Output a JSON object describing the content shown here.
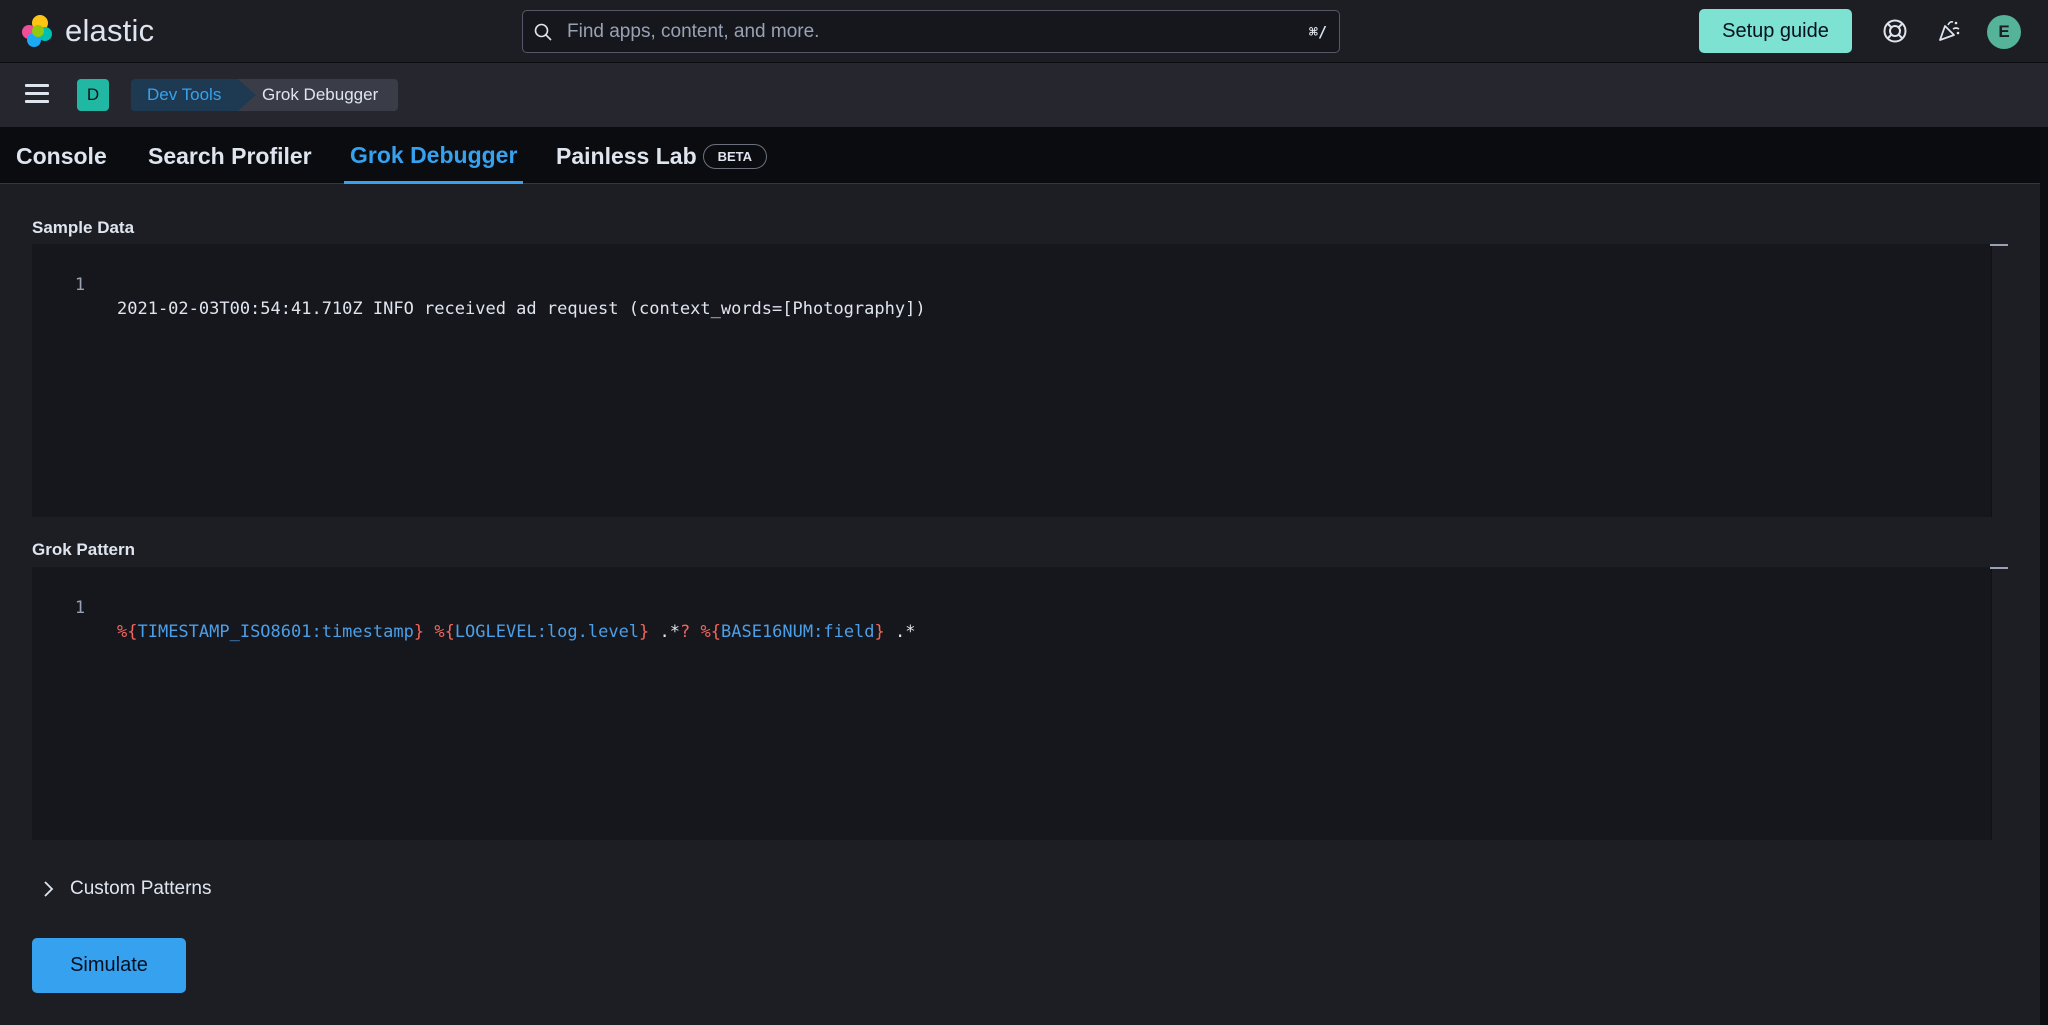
{
  "header": {
    "logo_text": "elastic",
    "search_placeholder": "Find apps, content, and more.",
    "search_shortcut": "⌘/",
    "setup_guide_label": "Setup guide",
    "icons": [
      "help-icon",
      "newsfeed-icon",
      "user-avatar"
    ],
    "avatar_initial": "E"
  },
  "nav": {
    "space_initial": "D",
    "breadcrumbs": [
      "Dev Tools",
      "Grok Debugger"
    ]
  },
  "tabs": [
    {
      "label": "Console",
      "active": false
    },
    {
      "label": "Search Profiler",
      "active": false
    },
    {
      "label": "Grok Debugger",
      "active": true
    },
    {
      "label": "Painless Lab",
      "active": false,
      "badge": "BETA"
    }
  ],
  "sample_data": {
    "label": "Sample Data",
    "line_number": "1",
    "text": "2021-02-03T00:54:41.710Z INFO received ad request (context_words=[Photography])"
  },
  "grok_pattern": {
    "label": "Grok Pattern",
    "line_number": "1",
    "tokens": [
      {
        "text": "%{",
        "color": "red"
      },
      {
        "text": "TIMESTAMP_ISO8601:timestamp",
        "color": "blue"
      },
      {
        "text": "}",
        "color": "red"
      },
      {
        "text": " ",
        "color": "white"
      },
      {
        "text": "%{",
        "color": "red"
      },
      {
        "text": "LOGLEVEL:log.level",
        "color": "blue"
      },
      {
        "text": "}",
        "color": "red"
      },
      {
        "text": " .*",
        "color": "white"
      },
      {
        "text": "?",
        "color": "red"
      },
      {
        "text": " ",
        "color": "white"
      },
      {
        "text": "%{",
        "color": "red"
      },
      {
        "text": "BASE16NUM:field",
        "color": "blue"
      },
      {
        "text": "}",
        "color": "red"
      },
      {
        "text": " .*",
        "color": "white"
      }
    ]
  },
  "custom_patterns": {
    "label": "Custom Patterns"
  },
  "simulate_label": "Simulate",
  "colors": {
    "accent": "#36a2ef",
    "setup_button": "#7de2d1",
    "background": "#1d1e24",
    "grok_bracket": "#f2665c",
    "grok_name": "#4a9fe8"
  }
}
